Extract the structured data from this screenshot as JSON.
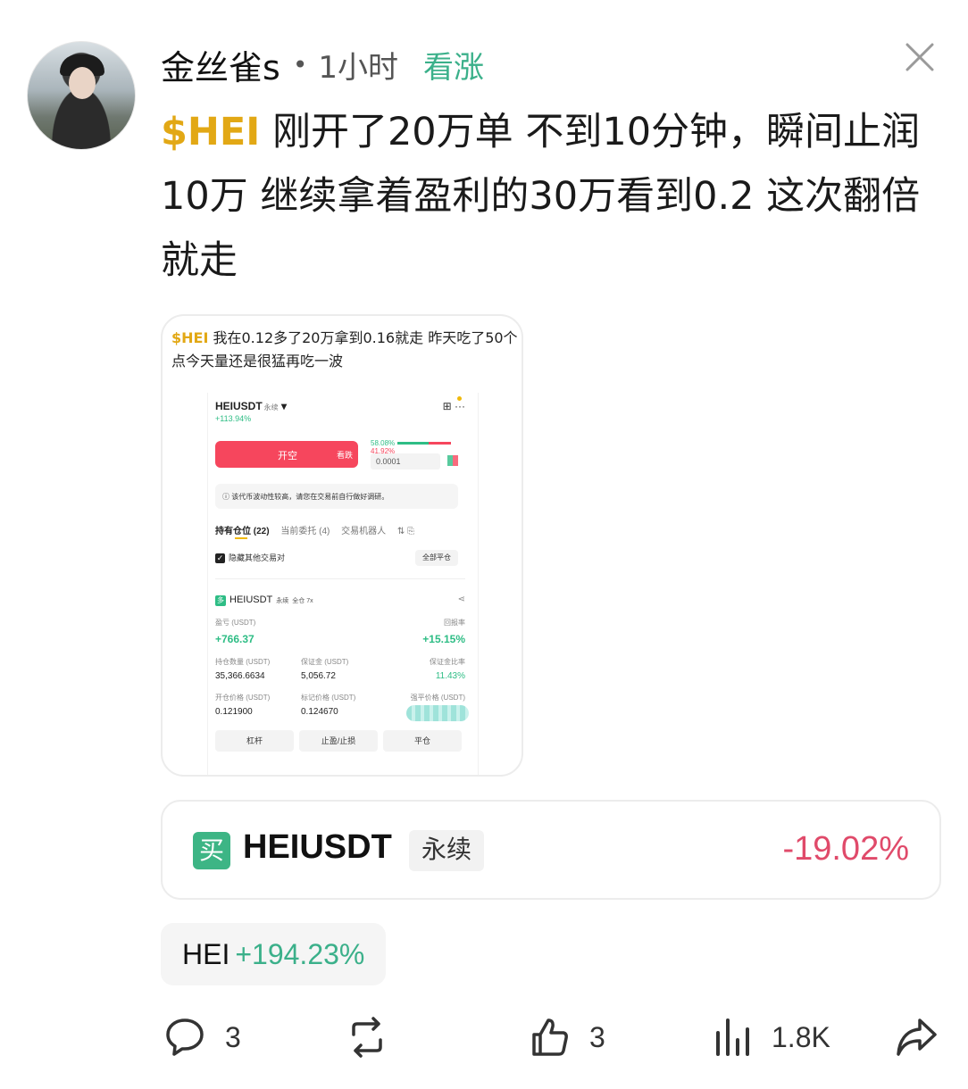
{
  "post": {
    "username": "金丝雀s",
    "separator": "•",
    "time": "1小时",
    "sentiment": "看涨",
    "ticker": "$HEI",
    "text": " 刚开了20万单 不到10分钟，瞬间止润10万  继续拿着盈利的30万看到0.2 这次翻倍就走"
  },
  "screenshot": {
    "caption_ticker": "$HEI",
    "caption_text": " 我在0.12多了20万拿到0.16就走 昨天吃了50个点今天量还是很猛再吃一波",
    "app": {
      "symbol": "HEIUSDT",
      "symbol_tag": "永续",
      "change": "+113.94%",
      "open_short": "开空",
      "open_short_sub": "看跌",
      "ratio_up": "58.08%",
      "ratio_down": "41.92%",
      "precision": "0.0001",
      "warning": "ⓘ 该代币波动性较高，请您在交易前自行做好调研。",
      "tab_positions": "持有仓位 (22)",
      "tab_orders": "当前委托 (4)",
      "tab_bots": "交易机器人",
      "hide_other": "隐藏其他交易对",
      "close_all": "全部平仓",
      "position": {
        "side": "多",
        "symbol": "HEIUSDT",
        "tag1": "永续",
        "tag2": "全仓 7x",
        "pnl_label": "盈亏 (USDT)",
        "pnl_value": "+766.37",
        "roe_label": "回报率",
        "roe_value": "+15.15%",
        "size_label": "持仓数量 (USDT)",
        "size_value": "35,366.6634",
        "margin_label": "保证金 (USDT)",
        "margin_value": "5,056.72",
        "margin_ratio_label": "保证金比率",
        "margin_ratio_value": "11.43%",
        "entry_label": "开仓价格 (USDT)",
        "entry_value": "0.121900",
        "mark_label": "标记价格 (USDT)",
        "mark_value": "0.124670",
        "liq_label": "强平价格 (USDT)"
      },
      "btn_leverage": "杠杆",
      "btn_tpsl": "止盈/止损",
      "btn_close": "平仓"
    }
  },
  "trade_card": {
    "badge": "买",
    "symbol": "HEIUSDT",
    "type": "永续",
    "change": "-19.02%"
  },
  "token_chip": {
    "symbol": "HEI",
    "change": "+194.23%"
  },
  "actions": {
    "comments": "3",
    "reposts": "",
    "likes": "3",
    "views": "1.8K"
  },
  "colors": {
    "ticker": "#e2a815",
    "bullish": "#3bb08a",
    "bearish": "#e04a6a"
  },
  "icons": [
    "close-icon",
    "comment-icon",
    "repost-icon",
    "like-icon",
    "views-icon",
    "share-icon"
  ]
}
